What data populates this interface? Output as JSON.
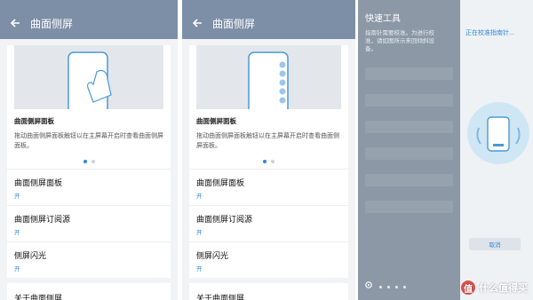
{
  "panel1": {
    "title": "曲面侧屏",
    "section_title": "曲面侧屏面板",
    "description": "拖动曲面侧屏面板触钮以在主屏幕开启时查看曲面侧屏面板。",
    "items": [
      {
        "title": "曲面侧屏面板",
        "sub": "开"
      },
      {
        "title": "曲面侧屏订阅源",
        "sub": "开"
      },
      {
        "title": "侧屏闪光",
        "sub": "开"
      }
    ],
    "about": "关于曲面侧屏"
  },
  "panel2": {
    "title": "曲面侧屏",
    "section_title": "曲面侧屏面板",
    "description": "拖动曲面侧屏面板触钮以在主屏幕开启时查看曲面侧屏面板。",
    "items": [
      {
        "title": "曲面侧屏面板",
        "sub": "开"
      },
      {
        "title": "曲面侧屏订阅源",
        "sub": "开"
      },
      {
        "title": "侧屏闪光",
        "sub": "开"
      }
    ],
    "about": "关于曲面侧屏"
  },
  "panel3": {
    "tools_title": "快速工具",
    "tools_desc": "指南针需要校准。为进行校准，请如图所示来回倾斜设备。",
    "calib_title": "正在校准指南针...",
    "cancel": "取消"
  },
  "watermark": "什么值得买",
  "watermark_badge": "值",
  "colors": {
    "accent": "#2f86d8",
    "appbar": "#7d8fa6"
  }
}
